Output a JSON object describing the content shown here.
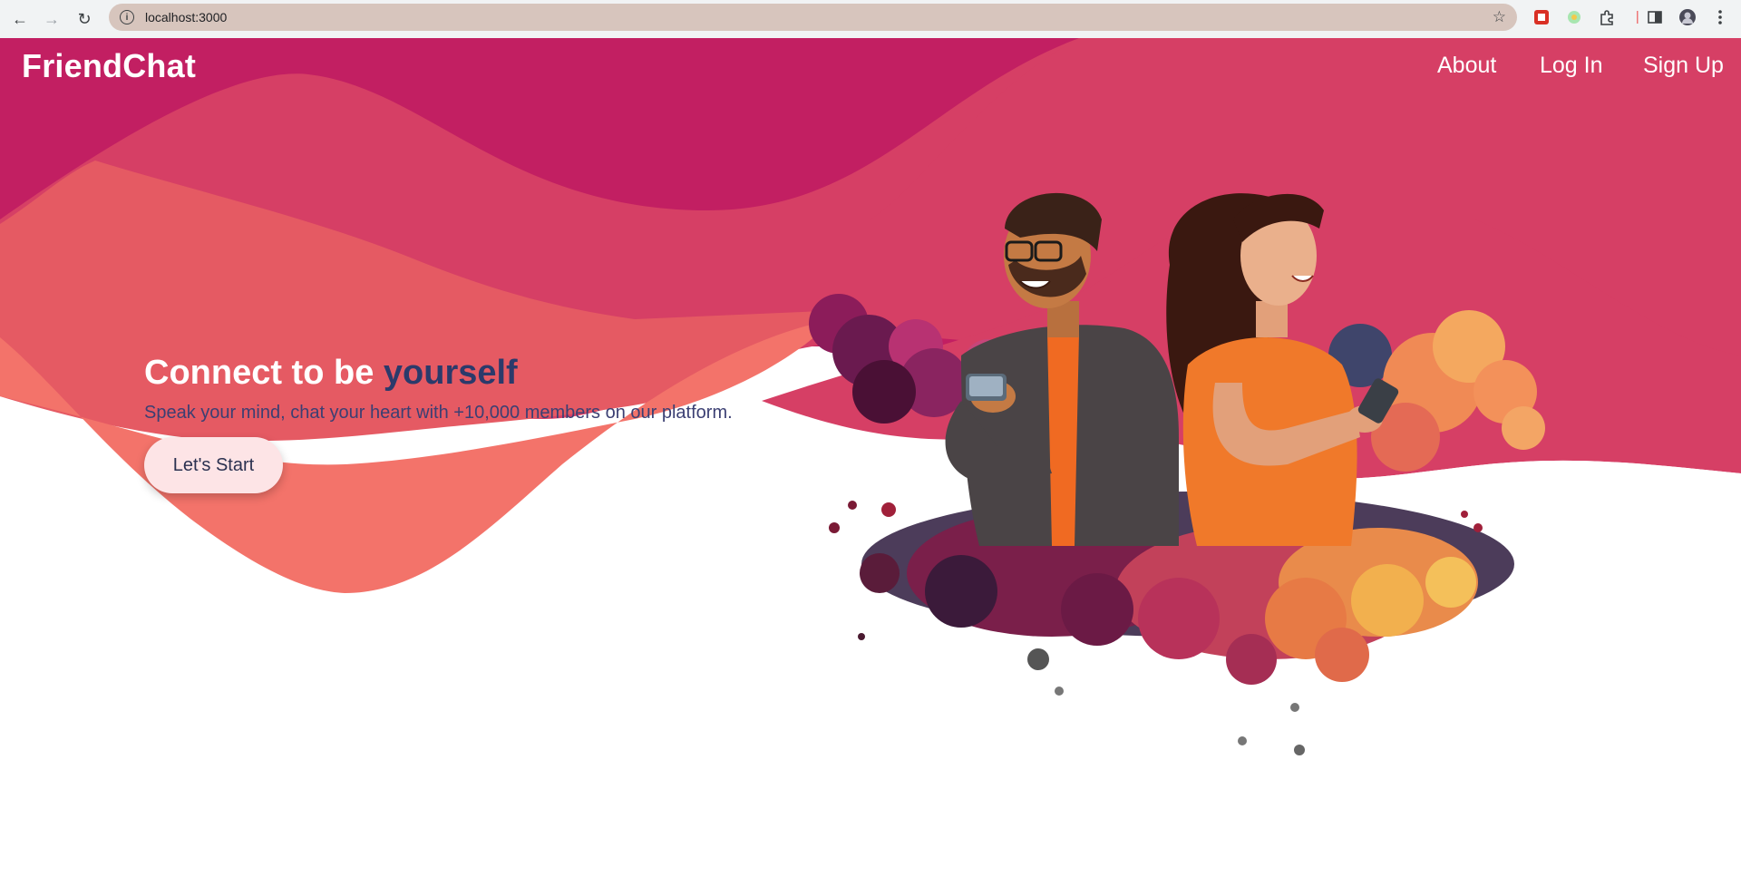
{
  "browser": {
    "url": "localhost:3000",
    "icons": {
      "back": "back-arrow-icon",
      "forward": "forward-arrow-icon",
      "reload": "reload-icon",
      "site_info": "site-info-icon",
      "bookmark": "bookmark-star-icon",
      "extensions": "puzzle-icon",
      "side_panel": "side-panel-icon",
      "profile": "profile-avatar",
      "menu": "kebab-menu-icon"
    }
  },
  "nav": {
    "brand": "FriendChat",
    "links": [
      "About",
      "Log In",
      "Sign Up"
    ]
  },
  "hero": {
    "headline_lead": "Connect to be",
    "headline_accent": "yourself",
    "subtext": "Speak your mind, chat your heart with +10,000 members on our platform.",
    "cta_label": "Let's Start"
  },
  "colors": {
    "wave_dark": "#c21f62",
    "wave_mid": "#d63f65",
    "wave_light": "#e55a63",
    "wave_coral": "#f3736a",
    "accent_text": "#2b3a6b",
    "cta_bg": "#fde4e6"
  }
}
